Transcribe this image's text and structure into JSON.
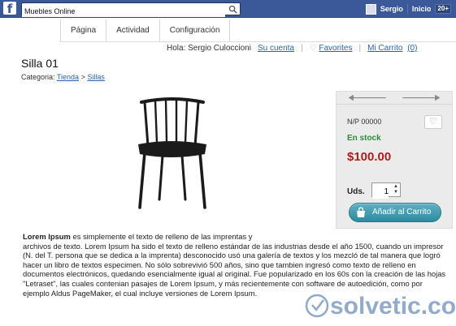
{
  "facebook": {
    "logo": "f",
    "search_value": "Muebles Online",
    "user_name": "Sergio",
    "home_label": "Inicio",
    "notification_badge": "20+"
  },
  "nav": {
    "tabs": [
      "Página",
      "Actividad",
      "Configuración"
    ]
  },
  "user_bar": {
    "greeting": "Hola: Sergio Culoccioni",
    "account_link": "Su cuenta",
    "favorites_link": "Favorites",
    "cart_link": "Mi Carrito",
    "cart_count": "(0)"
  },
  "product": {
    "title": "Silla 01",
    "category_label": "Categoria:",
    "breadcrumb": [
      "Tienda",
      "Sillas"
    ],
    "breadcrumb_sep": ">",
    "part_number": "N/P 00000",
    "stock_status": "En stock",
    "price": "$100.00",
    "qty_label": "Uds.",
    "qty_value": "1",
    "add_to_cart": "Añadir al Carrito"
  },
  "description": {
    "bold_lead": "Lorem Ipsum",
    "line1": " es simplemente el texto de relleno de las imprentas y",
    "rest": "archivos de texto. Lorem Ipsum ha sido el texto de relleno estándar de las industrias desde el año 1500, cuando un impresor (N. del T. persona que se dedica a la imprenta) desconocido usó una galería de textos y los mezcló de tal manera que logró hacer un libro de textos especimen. No sólo sobrevivió 500 años, sino que tambien ingresó como texto de relleno en documentos electrónicos, quedando esencialmente igual al original. Fue popularizado en los 60s con la creación de las hojas \"Letraset\", las cuales contenian pasajes de Lorem Ipsum, y más recientemente con software de autoedición, como por ejemplo Aldus PageMaker, el cual incluye versiones de Lorem Ipsum."
  },
  "watermark": {
    "text": "solvetic.com"
  },
  "colors": {
    "facebook_blue": "#3b5998",
    "link": "#2d64a8",
    "stock_green": "#2e8b3a",
    "price_red": "#b31b1b",
    "cart_button": "#3a9aae"
  }
}
